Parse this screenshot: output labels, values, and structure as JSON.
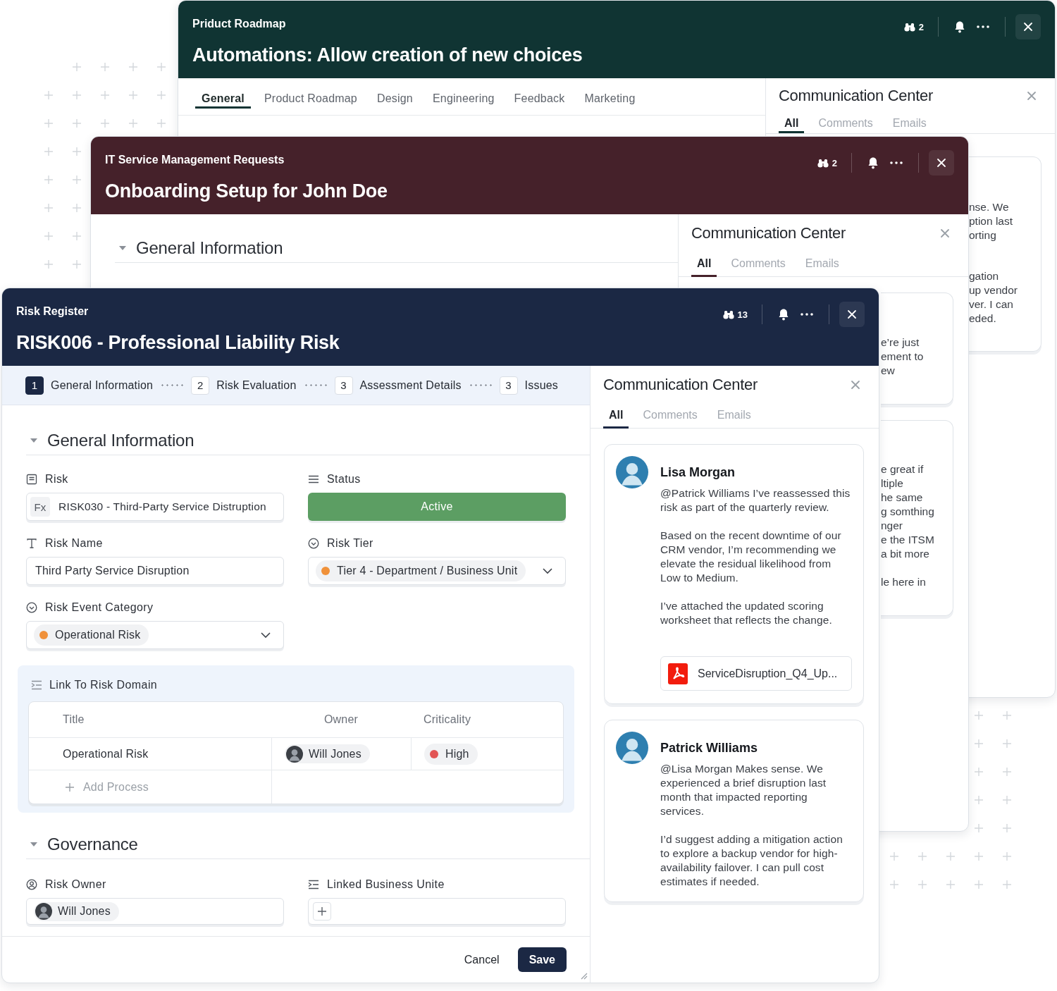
{
  "windows": [
    {
      "app": "Priduct Roadmap",
      "title": "Automations: Allow creation of new choices",
      "watchers": "2",
      "color": "#103433",
      "tabs": [
        {
          "label": "General",
          "selected": true
        },
        {
          "label": "Product Roadmap",
          "selected": false
        },
        {
          "label": "Design",
          "selected": false
        },
        {
          "label": "Engineering",
          "selected": false
        },
        {
          "label": "Feedback",
          "selected": false
        },
        {
          "label": "Marketing",
          "selected": false
        }
      ],
      "communication_center": {
        "title": "Communication Center",
        "tabs": [
          {
            "label": "All",
            "selected": true
          },
          {
            "label": "Comments",
            "selected": false
          },
          {
            "label": "Emails",
            "selected": false
          }
        ],
        "cards": [
          {
            "paragraphs": [
              [
                "nse. We",
                "ption last",
                "orting"
              ],
              [
                "gation",
                "up vendor",
                "ver. I can",
                "eded."
              ]
            ]
          }
        ]
      }
    },
    {
      "app": "IT Service Management Requests",
      "title": "Onboarding Setup for John Doe",
      "watchers": "2",
      "color": "#45212a",
      "section": "General Information",
      "communication_center": {
        "title": "Communication Center",
        "tabs": [
          {
            "label": "All",
            "selected": true
          },
          {
            "label": "Comments",
            "selected": false
          },
          {
            "label": "Emails",
            "selected": false
          }
        ],
        "cards": [
          {
            "paragraphs": [
              [
                "e’re just",
                "ement to",
                "ew"
              ]
            ]
          },
          {
            "paragraphs": [
              [
                "e great if",
                "ltiple",
                "he same",
                "g somthing",
                "nger",
                "e the ITSM",
                "a bit more"
              ],
              [
                "le here in"
              ]
            ]
          }
        ]
      }
    }
  ],
  "main_window": {
    "app": "Risk Register",
    "title": "RISK006 - Professional Liability Risk",
    "watchers": "13",
    "color": "#1b2844",
    "steps": [
      {
        "number": "1",
        "label": "General Information",
        "selected": true
      },
      {
        "number": "2",
        "label": "Risk Evaluation",
        "selected": false
      },
      {
        "number": "3",
        "label": "Assessment Details",
        "selected": false
      },
      {
        "number": "3",
        "label": "Issues",
        "selected": false
      }
    ],
    "general_information": {
      "title": "General Information",
      "fields": [
        {
          "kind": "formula",
          "label": "Risk",
          "prefix": "Fx",
          "value": "RISK030 - Third-Party Service Distruption"
        },
        {
          "kind": "status",
          "label": "Status",
          "value": "Active"
        },
        {
          "kind": "text",
          "label": "Risk Name",
          "value": "Third Party Service Disruption"
        },
        {
          "kind": "select",
          "label": "Risk Tier",
          "value": "Tier 4 - Department / Business Unit",
          "color": "#f0913a"
        },
        {
          "kind": "select",
          "label": "Risk Event Category",
          "value": "Operational Risk",
          "color": "#f0913a"
        }
      ]
    },
    "link_to_risk_domain": {
      "title": "Link To Risk Domain",
      "columns": [
        "Title",
        "Owner",
        "Criticality"
      ],
      "rows": [
        {
          "title": "Operational Risk",
          "owner": "Will Jones",
          "criticality": "High",
          "color": "#e25555"
        }
      ],
      "add_label": "Add Process"
    },
    "governance": {
      "title": "Governance",
      "fields": [
        {
          "kind": "person",
          "label": "Risk Owner",
          "value": "Will Jones"
        },
        {
          "kind": "relation",
          "label": "Linked Business Unite"
        }
      ]
    },
    "footer": {
      "cancel": "Cancel",
      "save": "Save"
    },
    "communication_center": {
      "title": "Communication Center",
      "tabs": [
        {
          "label": "All",
          "selected": true
        },
        {
          "label": "Comments",
          "selected": false
        },
        {
          "label": "Emails",
          "selected": false
        }
      ],
      "comments": [
        {
          "author": "Lisa Morgan",
          "paragraphs": [
            "@Patrick Williams I’ve reassessed this risk as part of the quarterly review.",
            "Based on the recent downtime of our CRM vendor, I’m recommending we elevate the residual likelihood from Low to Medium.",
            "I’ve attached the updated scoring worksheet that reflects the change."
          ],
          "attachment": "ServiceDisruption_Q4_Up..."
        },
        {
          "author": "Patrick Williams",
          "paragraphs": [
            "@Lisa Morgan Makes sense. We experienced a brief disruption last month that impacted reporting services.",
            "I’d suggest adding a mitigation action to explore a backup vendor for high-availability failover. I can pull cost estimates if needed."
          ]
        }
      ]
    }
  }
}
